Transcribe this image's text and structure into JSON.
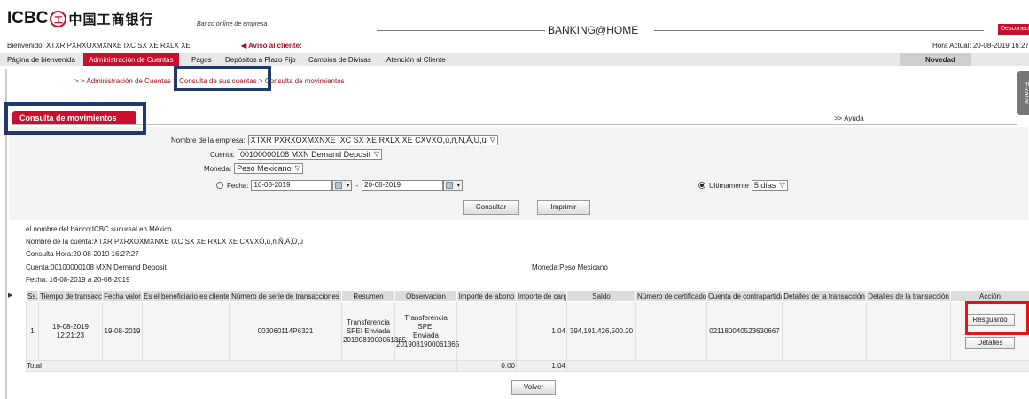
{
  "header": {
    "brand": "ICBC",
    "seal": "工",
    "brand_cn": "中国工商银行",
    "subtitle": "Banco online de empresa",
    "app_title": "BANKING@HOME",
    "logout": "Desconectar"
  },
  "status": {
    "welcome": "Bienvenido: XTXR PXRXOXMXNXE IXC SX XE RXLX XE",
    "notice": "◀ Aviso al cliente:",
    "clock": "Hora Actual: 20-08-2019 16:27"
  },
  "nav": {
    "items": [
      "Página de bienvenida",
      "Administración de Cuentas",
      "Pagos",
      "Depósitos a Plazo Fijo",
      "Cambios de Divisas",
      "Atención al Cliente"
    ],
    "novedad": "Novedad"
  },
  "breadcrumb": {
    "prefix": "> > ",
    "level1": "Administración de Cuentas",
    "sep": " > ",
    "level2": "Consulta de sus cuentas",
    "level3": "Consulta de movimientos"
  },
  "side": {
    "ecanal": "E-canal"
  },
  "section": {
    "title": "Consulta de movimientos",
    "help": ">> Ayuda"
  },
  "form": {
    "company_label": "Nombre de la empresa:",
    "company_value": "XTXR PXRXOXMXNXE IXC SX XE RXLX XE CXVXO,ú,ñ,N,Á,U,ü",
    "account_label": "Cuenta:",
    "account_value": "00100000108 MXN Demand Deposit",
    "currency_label": "Moneda:",
    "currency_value": "Peso Mexicano",
    "date_label": "Fecha:",
    "date_from": "16-08-2019",
    "date_sep": "-",
    "date_to": "20-08-2019",
    "recent_label": "Ultimamente",
    "recent_value": "5 días",
    "query_button": "Consultar",
    "print_button": "Imprimir"
  },
  "info": {
    "bank": "el nombre del banco:ICBC sucursal en México",
    "account_name": "Nombre de la cuenta:XTXR PXRXOXMXNXE IXC SX XE RXLX XE CXVXÓ,ú,ñ,Ñ,Á,Ü,ü",
    "query_time": "Consulta Hora:20-08-2019 16:27:27",
    "account": "Cuenta:00100000108 MXN Demand Deposit",
    "currency": "Moneda:Peso Mexicano",
    "date_range": "Fecha: 16-08-2019 a 20-08-2019"
  },
  "table": {
    "headers": [
      "Ss.",
      "Tiempo de transacción",
      "Fecha valor",
      "Es el beneficiario es cliente?",
      "Número de serie de transacciones",
      "Resumen",
      "Observación",
      "Importe de abono",
      "Importe de cargo",
      "Saldo",
      "Número de certificado",
      "Cuenta de contrapartida",
      "Detalles de la transacción",
      "Detalles de la transacción",
      "Acción"
    ],
    "row": {
      "ss": "1",
      "time_date": "19-08-2019",
      "time_clock": "12:21:23",
      "value_date": "19-08-2019",
      "is_client": "",
      "serial": "003060114P6321",
      "summary_1": "Transferencia",
      "summary_2": "SPEI Enviada",
      "summary_3": "2019081900061365",
      "obs_1": "Transferencia SPEI",
      "obs_2": "Enviada",
      "obs_3": "2019081900061365",
      "credit": "",
      "debit": "1.04",
      "balance": "394,191,426,500.20",
      "cert": "",
      "counter_account": "021180040523630667",
      "details1": "",
      "details2": "",
      "action_receipt": "Resguardo",
      "action_details": "Detalles"
    },
    "total": {
      "label": "Total",
      "credit": "0.00",
      "debit": "1.04"
    }
  },
  "back_button": "Volver",
  "colors": {
    "brand_red": "#c8102e",
    "highlight_blue": "#1f3a6b",
    "highlight_red": "#ee1111"
  }
}
